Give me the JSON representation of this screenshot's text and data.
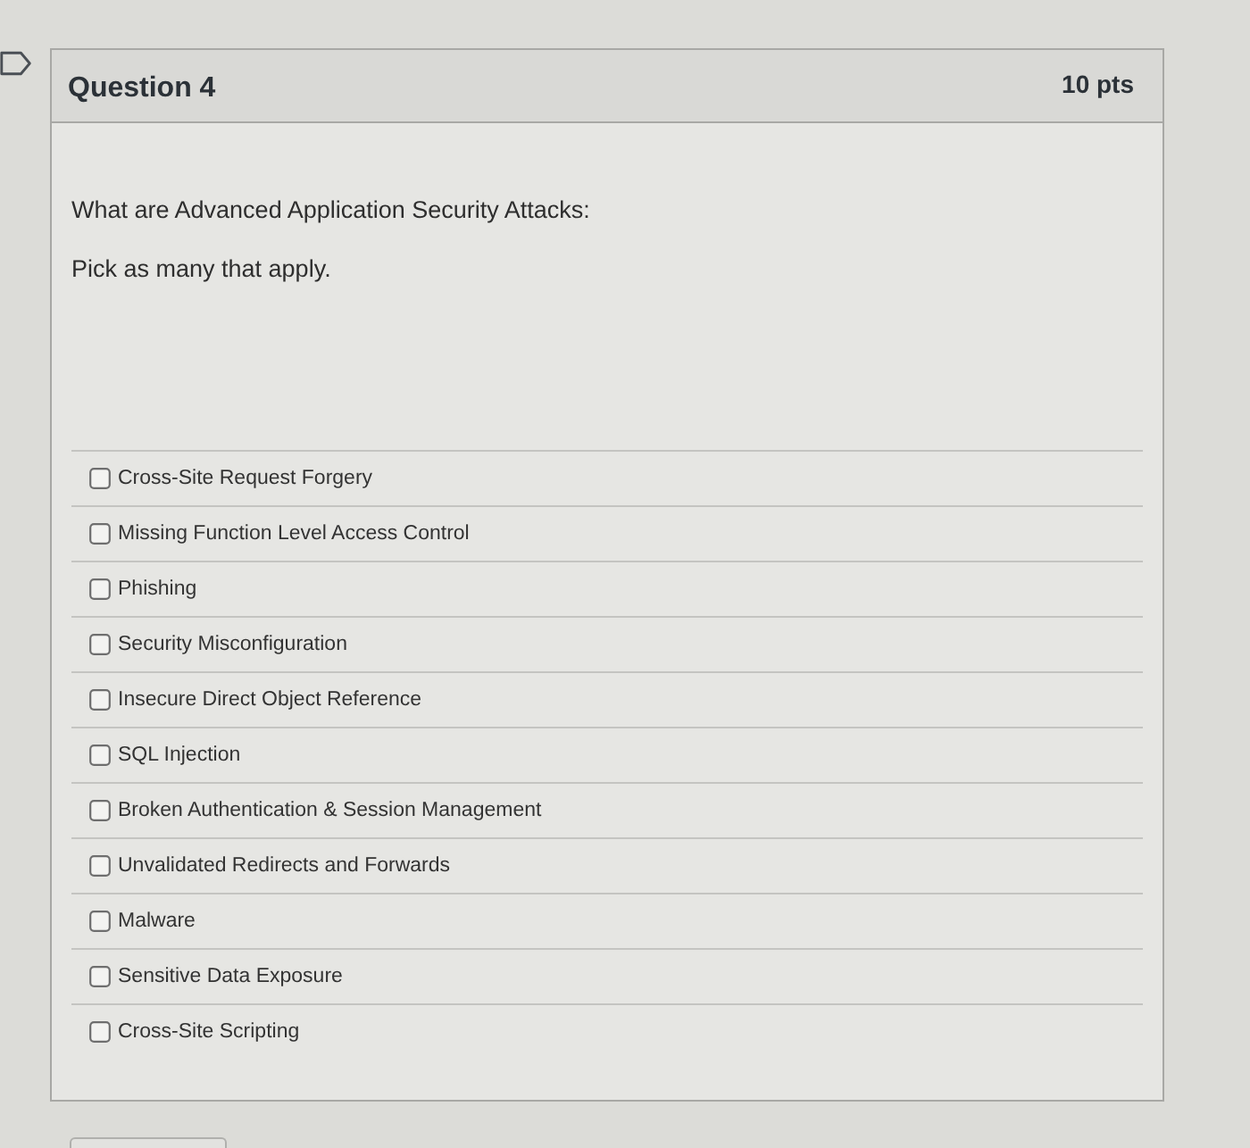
{
  "question": {
    "title": "Question 4",
    "points": "10 pts",
    "flagged": false
  },
  "prompt": "What are Advanced Application Security Attacks:",
  "instruction": "Pick as many that apply.",
  "answers": [
    {
      "label": "Cross-Site Request Forgery",
      "checked": false
    },
    {
      "label": "Missing Function Level Access Control",
      "checked": false
    },
    {
      "label": "Phishing",
      "checked": false
    },
    {
      "label": "Security Misconfiguration",
      "checked": false
    },
    {
      "label": "Insecure Direct Object Reference",
      "checked": false
    },
    {
      "label": "SQL Injection",
      "checked": false
    },
    {
      "label": "Broken Authentication & Session Management",
      "checked": false
    },
    {
      "label": "Unvalidated Redirects and Forwards",
      "checked": false
    },
    {
      "label": "Malware",
      "checked": false
    },
    {
      "label": "Sensitive Data Exposure",
      "checked": false
    },
    {
      "label": "Cross-Site Scripting",
      "checked": false
    }
  ]
}
